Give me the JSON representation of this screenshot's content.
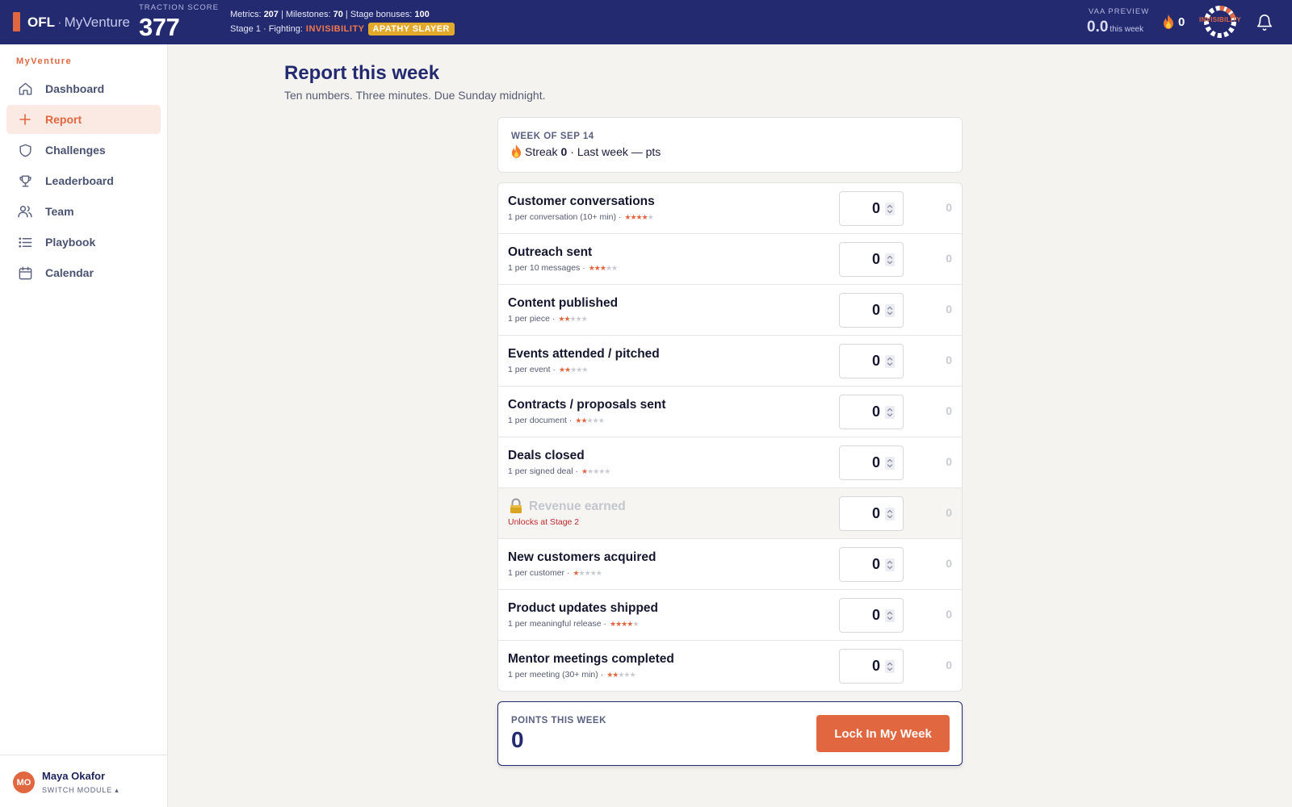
{
  "topbar": {
    "brand": "OFL",
    "brand_sep": "·",
    "venture": "MyVenture",
    "traction_label": "TRACTION SCORE",
    "traction_value": "377",
    "metrics_label": "Metrics:",
    "metrics_value": "207",
    "milestones_label": "| Milestones:",
    "milestones_value": "70",
    "bonuses_label": "| Stage bonuses:",
    "bonuses_value": "100",
    "stage_text": "Stage 1 · Fighting:",
    "fighting": "INVISIBILITY",
    "badge": "APATHY SLAYER",
    "vaa_label": "VAA PREVIEW",
    "vaa_value": "0.0",
    "vaa_unit": "this week",
    "streak_count": "0",
    "ring_label": "INVISIBILITY",
    "icons": [
      "fire-icon",
      "boss-ring-icon",
      "bell-icon"
    ]
  },
  "sidebar": {
    "title": "MyVenture",
    "items": [
      {
        "label": "Dashboard",
        "icon": "home-icon"
      },
      {
        "label": "Report",
        "icon": "plus-icon",
        "active": true
      },
      {
        "label": "Challenges",
        "icon": "shield-icon"
      },
      {
        "label": "Leaderboard",
        "icon": "trophy-icon"
      },
      {
        "label": "Team",
        "icon": "users-icon"
      },
      {
        "label": "Playbook",
        "icon": "list-icon"
      },
      {
        "label": "Calendar",
        "icon": "calendar-icon"
      }
    ],
    "user": {
      "initials": "MO",
      "name": "Maya Okafor",
      "switch_label": "SWITCH MODULE ▴"
    }
  },
  "main": {
    "title": "Report this week",
    "subtitle": "Ten numbers. Three minutes. Due Sunday midnight.",
    "week_label": "WEEK OF SEP 14",
    "streak_prefix": "Streak",
    "streak_value": "0",
    "last_week": "· Last week — pts",
    "metrics": [
      {
        "name": "Customer conversations",
        "rule": "1 per conversation (10+ min) ·",
        "stars": 4,
        "value": "0",
        "points": "0",
        "locked": false
      },
      {
        "name": "Outreach sent",
        "rule": "1 per 10 messages ·",
        "stars": 3,
        "value": "0",
        "points": "0",
        "locked": false
      },
      {
        "name": "Content published",
        "rule": "1 per piece ·",
        "stars": 2,
        "value": "0",
        "points": "0",
        "locked": false
      },
      {
        "name": "Events attended / pitched",
        "rule": "1 per event ·",
        "stars": 2,
        "value": "0",
        "points": "0",
        "locked": false
      },
      {
        "name": "Contracts / proposals sent",
        "rule": "1 per document ·",
        "stars": 2,
        "value": "0",
        "points": "0",
        "locked": false
      },
      {
        "name": "Deals closed",
        "rule": "1 per signed deal ·",
        "stars": 1,
        "value": "0",
        "points": "0",
        "locked": false
      },
      {
        "name": "Revenue earned",
        "rule": "Unlocks at Stage 2",
        "stars": 0,
        "value": "0",
        "points": "0",
        "locked": true
      },
      {
        "name": "New customers acquired",
        "rule": "1 per customer ·",
        "stars": 1,
        "value": "0",
        "points": "0",
        "locked": false
      },
      {
        "name": "Product updates shipped",
        "rule": "1 per meaningful release ·",
        "stars": 4,
        "value": "0",
        "points": "0",
        "locked": false
      },
      {
        "name": "Mentor meetings completed",
        "rule": "1 per meeting (30+ min) ·",
        "stars": 2,
        "value": "0",
        "points": "0",
        "locked": false
      }
    ],
    "points_label": "POINTS THIS WEEK",
    "points_value": "0",
    "lock_button": "Lock In My Week"
  },
  "colors": {
    "navy": "#232a70",
    "accent": "#e0673f",
    "badge": "#e3a92a",
    "locked_text": "#c0272d"
  }
}
